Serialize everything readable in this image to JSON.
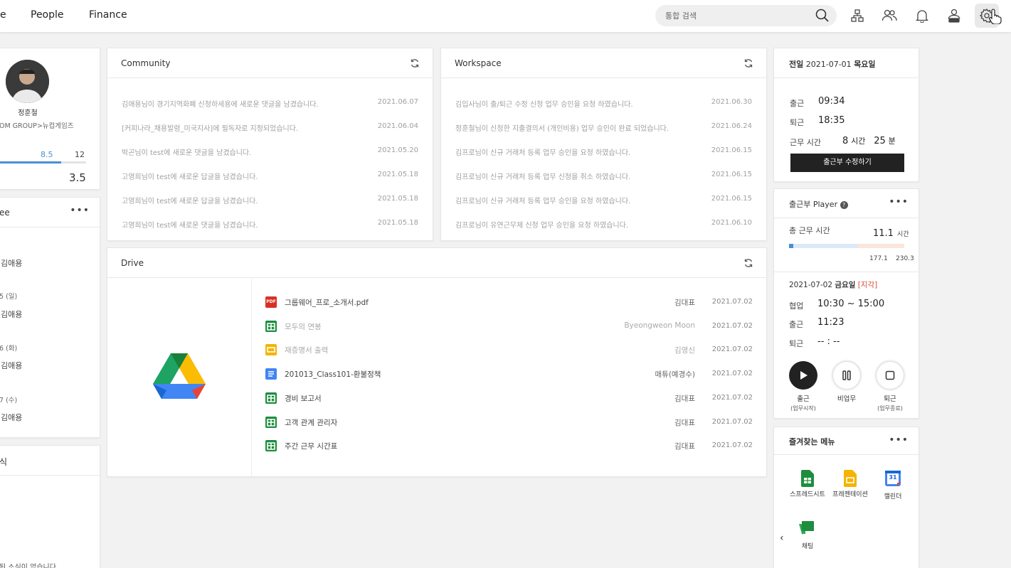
{
  "nav": {
    "items": [
      "e",
      "People",
      "Finance"
    ]
  },
  "search": {
    "placeholder": "통합 검색"
  },
  "icons": [
    "org-chart-icon",
    "users-icon",
    "bell-icon",
    "profile-badge-icon",
    "settings-icon"
  ],
  "profile": {
    "name": "정훈철",
    "org": "OM GROUP>뉴컵게임즈",
    "val1": "8.5",
    "val2": "12",
    "val3": "3.5",
    "progress": 0.71
  },
  "left_sched": {
    "title": "ee",
    "items": [
      {
        "date": "",
        "name": "김애용"
      },
      {
        "date": "5 (일)",
        "name": "김애용"
      },
      {
        "date": "6 (화)",
        "name": "김애용"
      },
      {
        "date": "7 (수)",
        "name": "김애용"
      }
    ]
  },
  "left_news": {
    "title": "식",
    "empty": "된 소식이 없습니다"
  },
  "community": {
    "title": "Community",
    "rows": [
      {
        "text": "김애용님이 경기지역화폐 신청하세용에 새로운 댓글을 남겼습니다.",
        "date": "2021.06.07"
      },
      {
        "text": "[커피나라_채용발령_미국지사]에 필독자로 지정되었습니다.",
        "date": "2021.06.04"
      },
      {
        "text": "박곤님이 test에 새로운 댓글을 남겼습니다.",
        "date": "2021.05.20"
      },
      {
        "text": "고영희님이 test에 새로운 답글을 남겼습니다.",
        "date": "2021.05.18"
      },
      {
        "text": "고영희님이 test에 새로운 답글을 남겼습니다.",
        "date": "2021.05.18"
      },
      {
        "text": "고영희님이 test에 새로운 댓글을 남겼습니다.",
        "date": "2021.05.18"
      }
    ]
  },
  "workspace": {
    "title": "Workspace",
    "rows": [
      {
        "text": "김입사님이 출/퇴근 수정 신청 업무 승인을 요청 하였습니다.",
        "date": "2021.06.30"
      },
      {
        "text": "정훈철님이 신청한 지출결의서 (개인비용) 업무 승인이 완료 되었습니다.",
        "date": "2021.06.24"
      },
      {
        "text": "김프로님이 신규 거래처 등록 업무 승인을 요청 하였습니다.",
        "date": "2021.06.15"
      },
      {
        "text": "김프로님이 신규 거래처 등록 업무 신청을 취소 하였습니다.",
        "date": "2021.06.15"
      },
      {
        "text": "김프로님이 신규 거래처 등록 업무 승인을 요청 하였습니다.",
        "date": "2021.06.15"
      },
      {
        "text": "김프로님이 유연근무제 신청 업무 승인을 요청 하였습니다.",
        "date": "2021.06.10"
      }
    ]
  },
  "drive": {
    "title": "Drive",
    "files": [
      {
        "icon": "pdf-icon",
        "color": "#d93025",
        "name": "그룹웨어_프로_소개서.pdf",
        "owner": "김대표",
        "date": "2021.07.02",
        "dim": false
      },
      {
        "icon": "sheets-icon",
        "color": "#1e8e3e",
        "name": "모두의 연봉",
        "owner": "Byeongweon Moon",
        "date": "2021.07.02",
        "dim": true
      },
      {
        "icon": "slides-icon",
        "color": "#f4b400",
        "name": "재증명서 출력",
        "owner": "김영신",
        "date": "2021.07.02",
        "dim": true
      },
      {
        "icon": "docs-icon",
        "color": "#4285f4",
        "name": "201013_Class101-환불정책",
        "owner": "매튜(예경수)",
        "date": "2021.07.02",
        "dim": false
      },
      {
        "icon": "sheets-icon",
        "color": "#1e8e3e",
        "name": "경비 보고서",
        "owner": "김대표",
        "date": "2021.07.02",
        "dim": false
      },
      {
        "icon": "sheets-icon",
        "color": "#1e8e3e",
        "name": "고객 관계 관리자",
        "owner": "김대표",
        "date": "2021.07.02",
        "dim": false
      },
      {
        "icon": "sheets-icon",
        "color": "#1e8e3e",
        "name": "주간 근무 시간표",
        "owner": "김대표",
        "date": "2021.07.02",
        "dim": false
      }
    ]
  },
  "attendance": {
    "prefix": "전일",
    "date": "2021-07-01",
    "weekday": "목요일",
    "in_label": "출근",
    "in_time": "09:34",
    "out_label": "퇴근",
    "out_time": "18:35",
    "work_label": "근무 시간",
    "hours": "8",
    "hours_unit": "시간",
    "minutes": "25",
    "minutes_unit": "분",
    "edit_button": "출근부 수정하기"
  },
  "player": {
    "title": "출근부 Player",
    "total_label": "총 근무 시간",
    "total_value": "11.1",
    "total_unit": "시간",
    "bar_a": "177.1",
    "bar_b": "230.3",
    "progress": 0.02,
    "date": "2021-07-02",
    "weekday": "금요일",
    "late": "[지각]",
    "r1_label": "협업",
    "r1_value": "10:30 ~ 15:00",
    "r2_label": "출근",
    "r2_value": "11:23",
    "r3_label": "퇴근",
    "r3_value": "-- : --",
    "btn_in": "출근",
    "btn_in_sub": "(업무시작)",
    "btn_pause": "비업무",
    "btn_out": "퇴근",
    "btn_out_sub": "(업무종료)"
  },
  "favorites": {
    "title": "즐겨찾는 메뉴",
    "items": [
      {
        "icon": "sheets-icon",
        "label": "스프레드시트"
      },
      {
        "icon": "slides-icon",
        "label": "프레젠테이션"
      },
      {
        "icon": "calendar-icon",
        "label": "캘린더",
        "num": "31"
      },
      {
        "icon": "chat-icon",
        "label": "채팅"
      }
    ]
  }
}
